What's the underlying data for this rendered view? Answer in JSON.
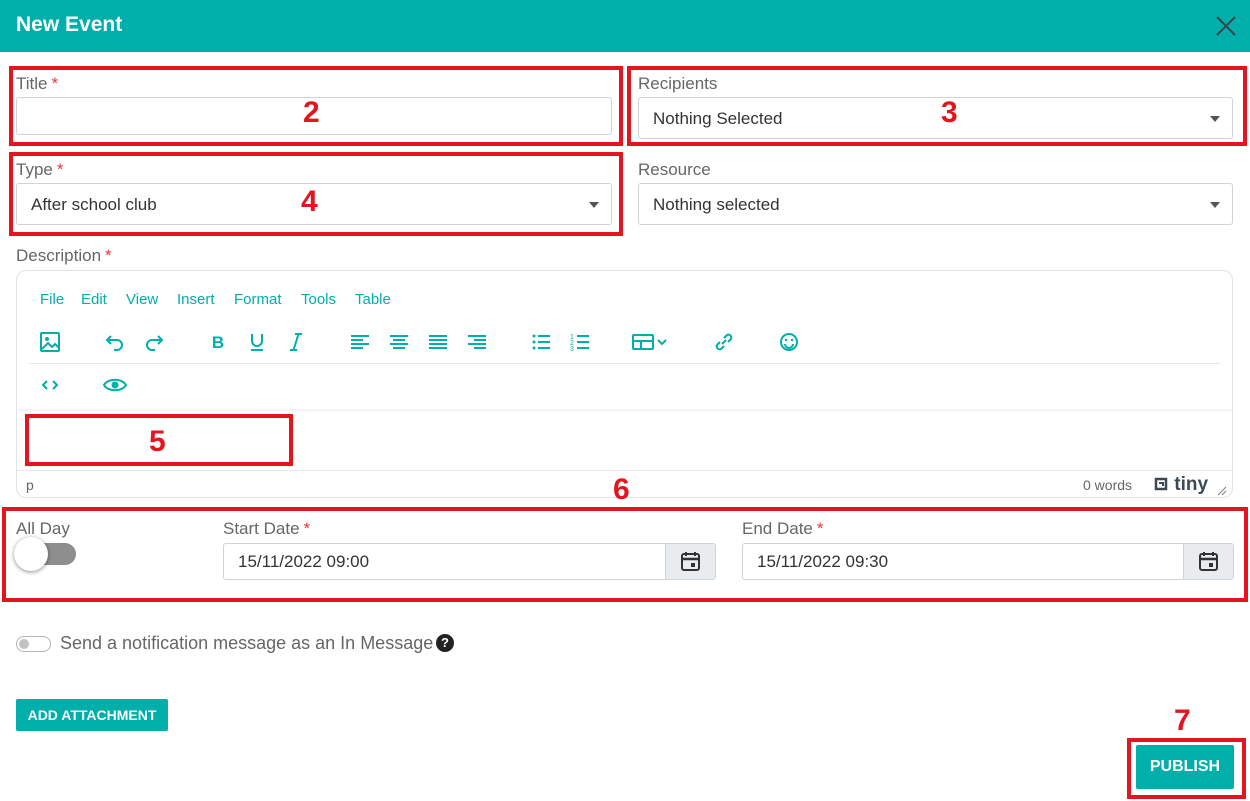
{
  "header": {
    "title": "New Event",
    "close_icon": "close-icon"
  },
  "form": {
    "title": {
      "label": "Title",
      "required": "*",
      "value": ""
    },
    "recipients": {
      "label": "Recipients",
      "value": "Nothing Selected"
    },
    "type": {
      "label": "Type",
      "required": "*",
      "value": "After school club"
    },
    "resource": {
      "label": "Resource",
      "value": "Nothing selected"
    },
    "description": {
      "label": "Description",
      "required": "*"
    }
  },
  "editor": {
    "menu": [
      "File",
      "Edit",
      "View",
      "Insert",
      "Format",
      "Tools",
      "Table"
    ],
    "toolbar_icons": [
      "image-icon",
      "undo-icon",
      "redo-icon",
      "bold-icon",
      "underline-icon",
      "italic-icon",
      "align-left-icon",
      "align-center-icon",
      "align-justify-icon",
      "align-right-icon",
      "bullet-list-icon",
      "numbered-list-icon",
      "table-icon",
      "link-icon",
      "emoji-icon",
      "code-icon",
      "preview-icon"
    ],
    "status_element": "p",
    "word_count": "0 words",
    "brand": "tiny"
  },
  "dates": {
    "all_day_label": "All Day",
    "all_day": false,
    "start": {
      "label": "Start Date",
      "required": "*",
      "value": "15/11/2022 09:00"
    },
    "end": {
      "label": "End Date",
      "required": "*",
      "value": "15/11/2022 09:30"
    }
  },
  "notification": {
    "label": "Send a notification message as an In Message",
    "enabled": false,
    "help": "?"
  },
  "buttons": {
    "add_attachment": "ADD ATTACHMENT",
    "publish": "PUBLISH"
  },
  "annotations": [
    "2",
    "3",
    "4",
    "5",
    "6",
    "7"
  ],
  "colors": {
    "accent": "#00AFAA",
    "annotation": "#e4151f",
    "required": "#e53935"
  }
}
